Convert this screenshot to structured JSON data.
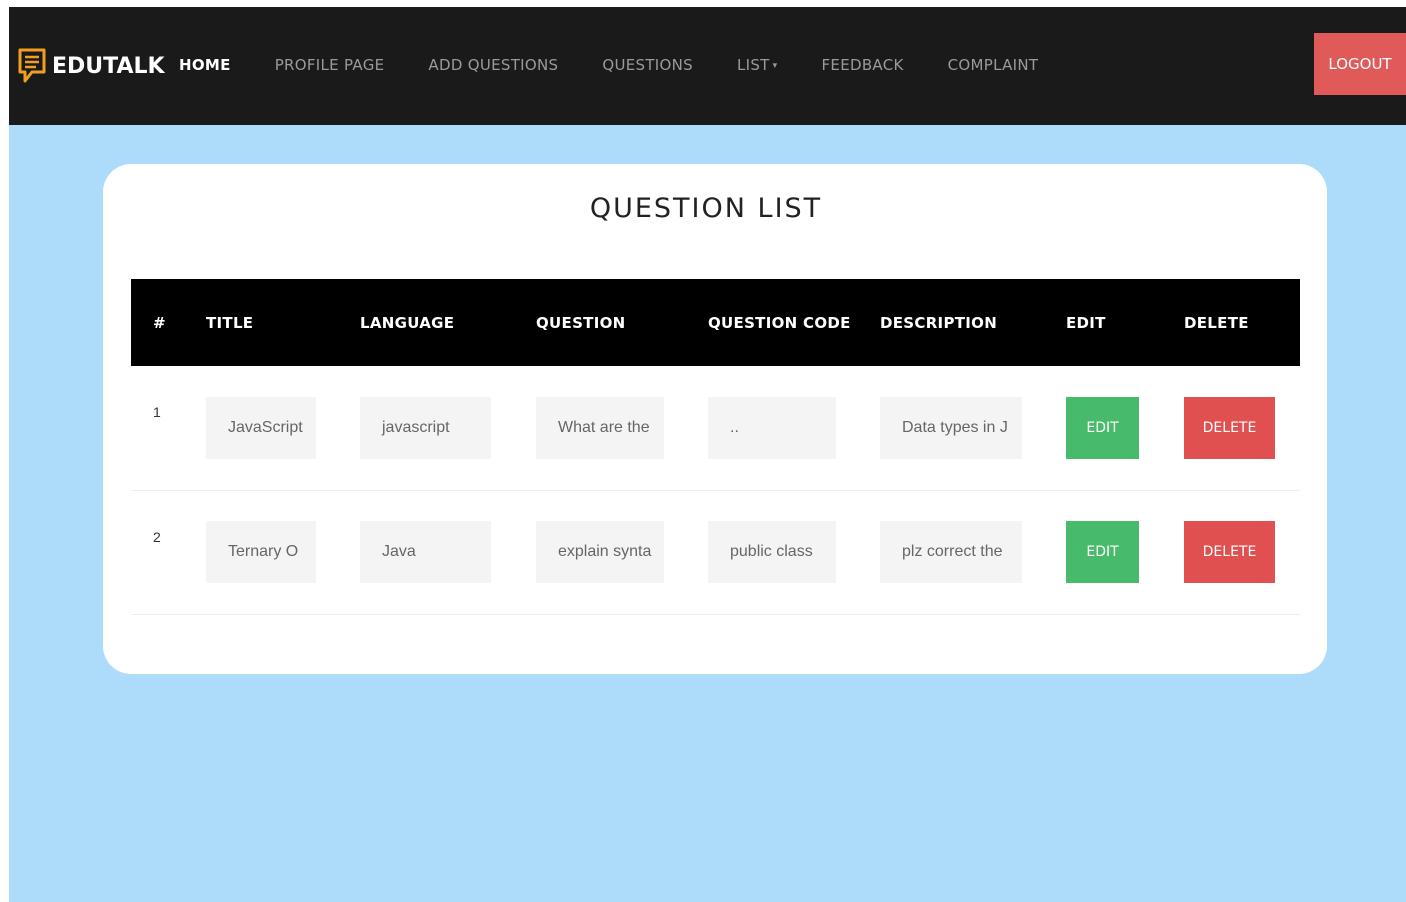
{
  "nav": {
    "brand": "EDUTALK",
    "items": [
      {
        "label": "HOME",
        "active": true
      },
      {
        "label": "PROFILE PAGE",
        "active": false
      },
      {
        "label": "ADD QUESTIONS",
        "active": false
      },
      {
        "label": "QUESTIONS",
        "active": false
      },
      {
        "label": "LIST",
        "active": false,
        "dropdown": true
      },
      {
        "label": "FEEDBACK",
        "active": false
      },
      {
        "label": "COMPLAINT",
        "active": false
      }
    ],
    "logout_label": "LOGOUT"
  },
  "page": {
    "title": "QUESTION LIST"
  },
  "table": {
    "headers": [
      "#",
      "TITLE",
      "LANGUAGE",
      "QUESTION",
      "QUESTION CODE",
      "DESCRIPTION",
      "EDIT",
      "DELETE"
    ],
    "rows": [
      {
        "num": "1",
        "title": "JavaScript",
        "language": "javascript",
        "question": "What are the",
        "code": "..",
        "description": "Data types in J",
        "edit": "EDIT",
        "delete": "DELETE"
      },
      {
        "num": "2",
        "title": "Ternary O",
        "language": "Java",
        "question": "explain synta",
        "code": "public class",
        "description": "plz correct the",
        "edit": "EDIT",
        "delete": "DELETE"
      }
    ]
  },
  "colors": {
    "navbar": "#1a1a1a",
    "background": "#acdcfa",
    "edit": "#47bb6b",
    "delete": "#e05050",
    "logout": "#e05a5a",
    "brand_icon": "#f0a020"
  },
  "icons": {
    "brand": "chat-bubble-icon",
    "dropdown": "caret-down-icon"
  }
}
